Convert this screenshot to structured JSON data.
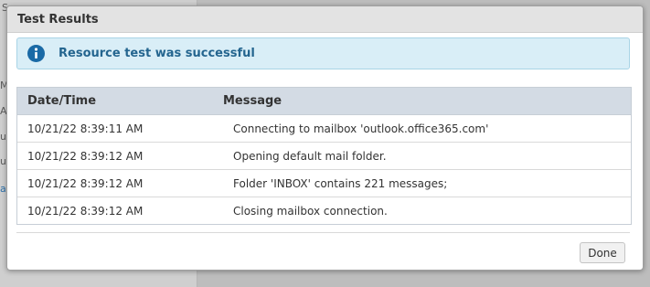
{
  "background": {
    "fragments": [
      "S",
      "M",
      "A",
      "u",
      "u",
      "a"
    ]
  },
  "dialog": {
    "title": "Test Results",
    "alert": {
      "icon": "info-icon",
      "text": "Resource test was successful",
      "color": "#1a6aa6"
    },
    "table": {
      "columns": [
        "Date/Time",
        "Message"
      ],
      "rows": [
        {
          "datetime": "10/21/22 8:39:11 AM",
          "message": "Connecting to mailbox 'outlook.office365.com'"
        },
        {
          "datetime": "10/21/22 8:39:12 AM",
          "message": "Opening default mail folder."
        },
        {
          "datetime": "10/21/22 8:39:12 AM",
          "message": "Folder 'INBOX' contains 221 messages;"
        },
        {
          "datetime": "10/21/22 8:39:12 AM",
          "message": "Closing mailbox connection."
        }
      ]
    },
    "done_label": "Done"
  }
}
